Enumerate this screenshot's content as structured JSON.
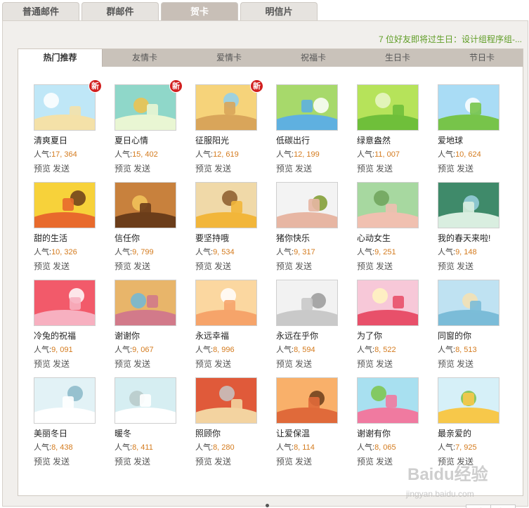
{
  "top_tabs": [
    "普通邮件",
    "群邮件",
    "贺卡",
    "明信片"
  ],
  "birthday_notice": "7 位好友即将过生日：设计组程序组-...",
  "sub_tabs": [
    "热门推荐",
    "友情卡",
    "爱情卡",
    "祝福卡",
    "生日卡",
    "节日卡"
  ],
  "labels": {
    "popularity": "人气:",
    "preview": "预览",
    "send": "发送",
    "new": "新"
  },
  "cards": [
    {
      "title": "清爽夏日",
      "popularity": "17, 364",
      "is_new": true,
      "icon": "summer-beach-card-icon"
    },
    {
      "title": "夏日心情",
      "popularity": "15, 402",
      "is_new": true,
      "icon": "summer-drinks-card-icon"
    },
    {
      "title": "征服阳光",
      "popularity": "12, 619",
      "is_new": true,
      "icon": "sand-castle-card-icon"
    },
    {
      "title": "低碳出行",
      "popularity": "12, 199",
      "is_new": false,
      "icon": "green-bus-card-icon"
    },
    {
      "title": "绿意盎然",
      "popularity": "11, 007",
      "is_new": false,
      "icon": "green-planet-card-icon"
    },
    {
      "title": "爱地球",
      "popularity": "10, 624",
      "is_new": false,
      "icon": "earth-meadow-card-icon"
    },
    {
      "title": "甜的生活",
      "popularity": "10, 326",
      "is_new": false,
      "icon": "candy-giraffe-card-icon"
    },
    {
      "title": "信任你",
      "popularity": "9, 799",
      "is_new": false,
      "icon": "dartboard-giraffe-card-icon"
    },
    {
      "title": "要坚持哦",
      "popularity": "9, 534",
      "is_new": false,
      "icon": "toolbox-giraffe-card-icon"
    },
    {
      "title": "猪你快乐",
      "popularity": "9, 317",
      "is_new": false,
      "icon": "happy-pig-card-icon"
    },
    {
      "title": "心动女生",
      "popularity": "9, 251",
      "is_new": false,
      "icon": "pig-girl-card-icon"
    },
    {
      "title": "我的春天来啦!",
      "popularity": "9, 148",
      "is_new": false,
      "icon": "spring-rain-card-icon"
    },
    {
      "title": "冷兔的祝福",
      "popularity": "9, 091",
      "is_new": false,
      "icon": "pink-rabbit-card-icon"
    },
    {
      "title": "谢谢你",
      "popularity": "9, 067",
      "is_new": false,
      "icon": "pinwheel-card-icon"
    },
    {
      "title": "永远幸福",
      "popularity": "8, 996",
      "is_new": false,
      "icon": "milk-bottle-card-icon"
    },
    {
      "title": "永远在乎你",
      "popularity": "8, 594",
      "is_new": false,
      "icon": "teddy-bears-card-icon"
    },
    {
      "title": "为了你",
      "popularity": "8, 522",
      "is_new": false,
      "icon": "heart-girl-card-icon"
    },
    {
      "title": "同窗的你",
      "popularity": "8, 513",
      "is_new": false,
      "icon": "classmates-card-icon"
    },
    {
      "title": "美丽冬日",
      "popularity": "8, 438",
      "is_new": false,
      "icon": "winter-couple-card-icon"
    },
    {
      "title": "暖冬",
      "popularity": "8, 411",
      "is_new": false,
      "icon": "warm-winter-card-icon"
    },
    {
      "title": "照顾你",
      "popularity": "8, 280",
      "is_new": false,
      "icon": "tram-station-card-icon"
    },
    {
      "title": "让爱保温",
      "popularity": "8, 114",
      "is_new": false,
      "icon": "couple-sunset-card-icon"
    },
    {
      "title": "谢谢有你",
      "popularity": "8, 065",
      "is_new": false,
      "icon": "balloon-girl-card-icon"
    },
    {
      "title": "最亲爱的",
      "popularity": "7, 925",
      "is_new": false,
      "icon": "village-houses-card-icon"
    }
  ],
  "pager": {
    "prev": "◀",
    "next": "▶"
  },
  "watermark": {
    "brand": "Baidu经验",
    "url": "jingyan.baidu.com"
  },
  "colors": {
    "accent_green": "#5f9d25",
    "popularity_orange": "#d47b1e",
    "new_badge_red": "#d11f1f",
    "tab_active": "#c8bfb7"
  }
}
